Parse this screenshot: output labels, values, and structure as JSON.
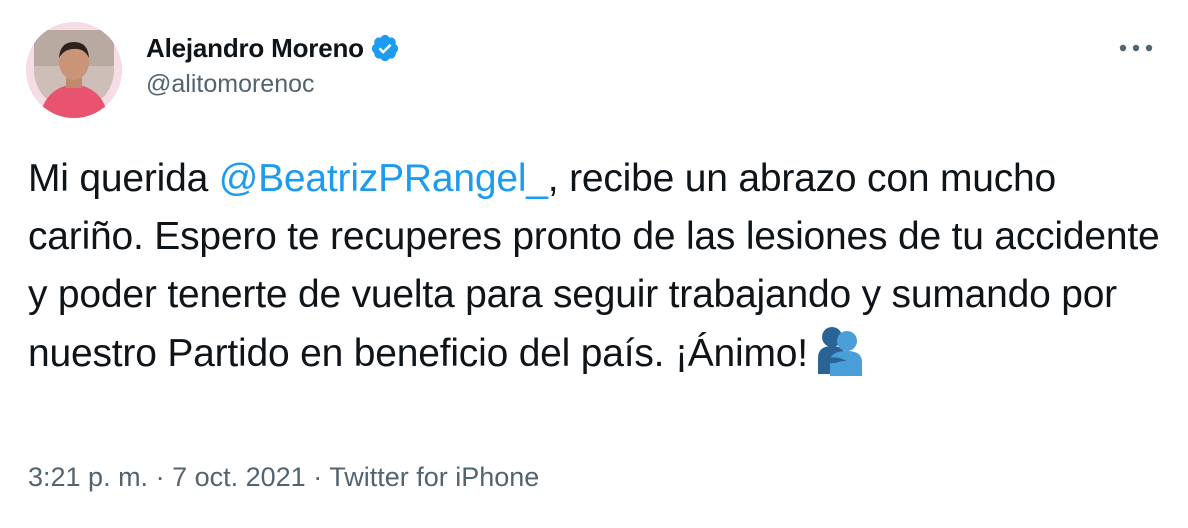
{
  "author": {
    "display_name": "Alejandro Moreno",
    "handle": "@alitomorenoc",
    "verified": true
  },
  "tweet": {
    "text_before_mention": "Mi querida ",
    "mention": "@BeatrizPRangel_",
    "text_after_mention": ", recibe un abrazo con mucho cariño. Espero te recuperes pronto de las lesiones de tu accidente y poder tenerte de vuelta para seguir trabajando y sumando por nuestro Partido en beneficio del país. ¡Ánimo!",
    "emoji": "people-hugging"
  },
  "meta": {
    "time": "3:21 p. m.",
    "separator": " · ",
    "date": "7 oct. 2021",
    "source": "Twitter for iPhone"
  },
  "colors": {
    "text": "#0f1419",
    "secondary": "#536471",
    "accent": "#1d9bf0",
    "avatar_ring": "#f6dce4",
    "shirt": "#e8546f"
  },
  "icons": {
    "more": "more-horizontal-icon",
    "verified": "verified-badge-icon"
  }
}
